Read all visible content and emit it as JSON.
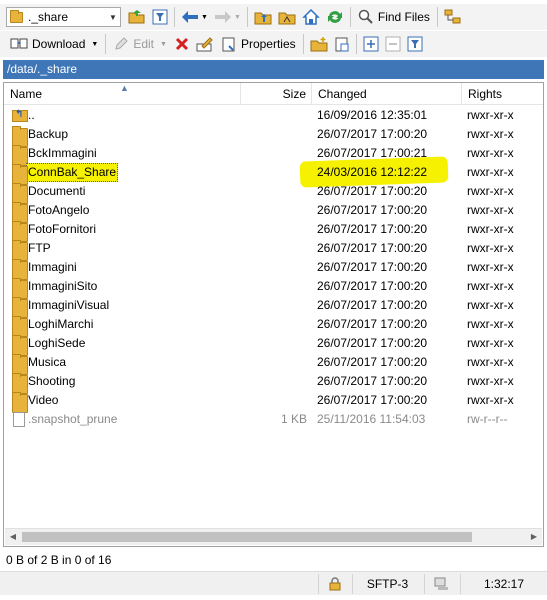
{
  "toolbar1": {
    "path_combo_value": "._share",
    "find_files_label": "Find Files",
    "icons": [
      "folder-icon",
      "open-folder-icon",
      "filter-icon",
      "back-icon",
      "forward-icon",
      "parent-dir-icon",
      "root-dir-icon",
      "home-icon",
      "refresh-icon",
      "find-files-icon",
      "tree-icon"
    ]
  },
  "toolbar2": {
    "download_label": "Download",
    "edit_label": "Edit",
    "properties_label": "Properties"
  },
  "path_bar": "/data/._share",
  "columns": {
    "name": "Name",
    "size": "Size",
    "changed": "Changed",
    "rights": "Rights"
  },
  "files": [
    {
      "name": "..",
      "size": "",
      "changed": "16/09/2016 12:35:01",
      "rights": "rwxr-xr-x",
      "type": "parent"
    },
    {
      "name": "Backup",
      "size": "",
      "changed": "26/07/2017 17:00:20",
      "rights": "rwxr-xr-x",
      "type": "folder"
    },
    {
      "name": "BckImmagini",
      "size": "",
      "changed": "26/07/2017 17:00:21",
      "rights": "rwxr-xr-x",
      "type": "folder"
    },
    {
      "name": "ConnBak_Share",
      "size": "",
      "changed": "24/03/2016 12:12:22",
      "rights": "rwxr-xr-x",
      "type": "folder",
      "highlighted": true
    },
    {
      "name": "Documenti",
      "size": "",
      "changed": "26/07/2017 17:00:20",
      "rights": "rwxr-xr-x",
      "type": "folder"
    },
    {
      "name": "FotoAngelo",
      "size": "",
      "changed": "26/07/2017 17:00:20",
      "rights": "rwxr-xr-x",
      "type": "folder"
    },
    {
      "name": "FotoFornitori",
      "size": "",
      "changed": "26/07/2017 17:00:20",
      "rights": "rwxr-xr-x",
      "type": "folder"
    },
    {
      "name": "FTP",
      "size": "",
      "changed": "26/07/2017 17:00:20",
      "rights": "rwxr-xr-x",
      "type": "folder"
    },
    {
      "name": "Immagini",
      "size": "",
      "changed": "26/07/2017 17:00:20",
      "rights": "rwxr-xr-x",
      "type": "folder"
    },
    {
      "name": "ImmaginiSito",
      "size": "",
      "changed": "26/07/2017 17:00:20",
      "rights": "rwxr-xr-x",
      "type": "folder"
    },
    {
      "name": "ImmaginiVisual",
      "size": "",
      "changed": "26/07/2017 17:00:20",
      "rights": "rwxr-xr-x",
      "type": "folder"
    },
    {
      "name": "LoghiMarchi",
      "size": "",
      "changed": "26/07/2017 17:00:20",
      "rights": "rwxr-xr-x",
      "type": "folder"
    },
    {
      "name": "LoghiSede",
      "size": "",
      "changed": "26/07/2017 17:00:20",
      "rights": "rwxr-xr-x",
      "type": "folder"
    },
    {
      "name": "Musica",
      "size": "",
      "changed": "26/07/2017 17:00:20",
      "rights": "rwxr-xr-x",
      "type": "folder"
    },
    {
      "name": "Shooting",
      "size": "",
      "changed": "26/07/2017 17:00:20",
      "rights": "rwxr-xr-x",
      "type": "folder"
    },
    {
      "name": "Video",
      "size": "",
      "changed": "26/07/2017 17:00:20",
      "rights": "rwxr-xr-x",
      "type": "folder"
    },
    {
      "name": ".snapshot_prune",
      "size": "1 KB",
      "changed": "25/11/2016 11:54:03",
      "rights": "rw-r--r--",
      "type": "file"
    }
  ],
  "summary": "0 B of 2 B in 0 of 16",
  "status": {
    "protocol": "SFTP-3",
    "time": "1:32:17"
  },
  "colors": {
    "path_bar": "#3f76b8",
    "highlight": "#f6f100",
    "folder": "#e8b33a"
  }
}
